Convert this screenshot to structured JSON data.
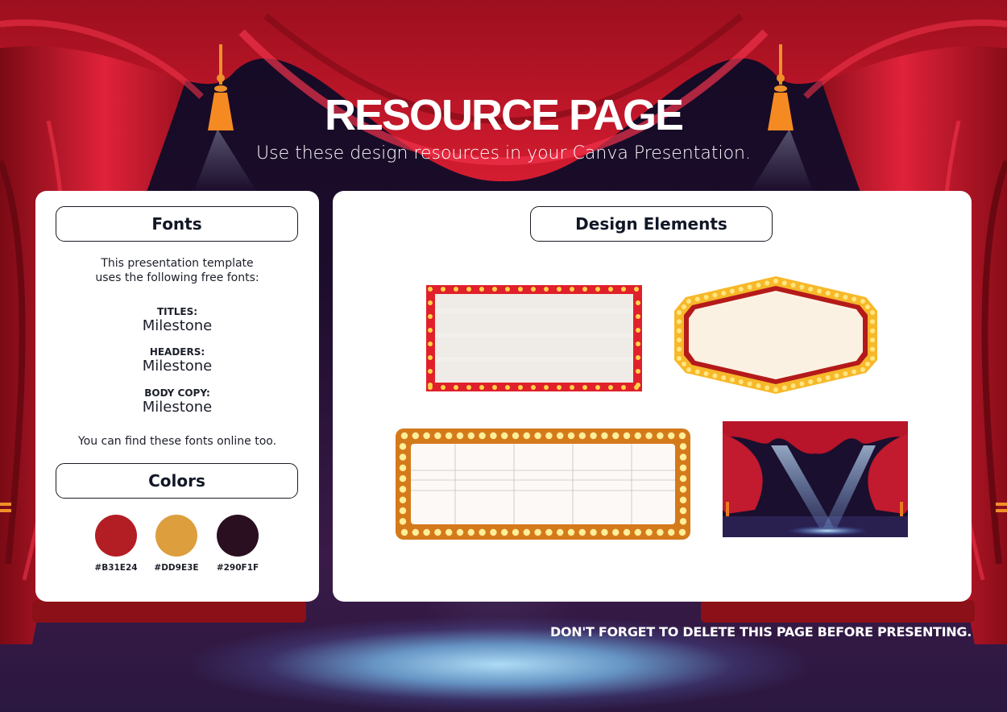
{
  "header": {
    "title": "RESOURCE PAGE",
    "subtitle": "Use these design resources in your Canva Presentation."
  },
  "fonts_panel": {
    "heading": "Fonts",
    "intro_line1": "This presentation template",
    "intro_line2": "uses the following free fonts:",
    "entries": [
      {
        "label": "TITLES:",
        "font": "Milestone"
      },
      {
        "label": "HEADERS:",
        "font": "Milestone"
      },
      {
        "label": "BODY COPY:",
        "font": "Milestone"
      }
    ],
    "outro": "You can find these fonts online too."
  },
  "colors_panel": {
    "heading": "Colors",
    "swatches": [
      {
        "hex": "#B31E24",
        "label": "#B31E24"
      },
      {
        "hex": "#DD9E3E",
        "label": "#DD9E3E"
      },
      {
        "hex": "#290F1F",
        "label": "#290F1F"
      }
    ]
  },
  "elements_panel": {
    "heading": "Design Elements",
    "items": [
      {
        "name": "red-marquee-frame"
      },
      {
        "name": "hexagon-marquee-sign"
      },
      {
        "name": "gold-marquee-board"
      },
      {
        "name": "stage-curtain-scene"
      }
    ]
  },
  "footer": {
    "note": "DON'T FORGET TO DELETE THIS PAGE BEFORE PRESENTING."
  }
}
